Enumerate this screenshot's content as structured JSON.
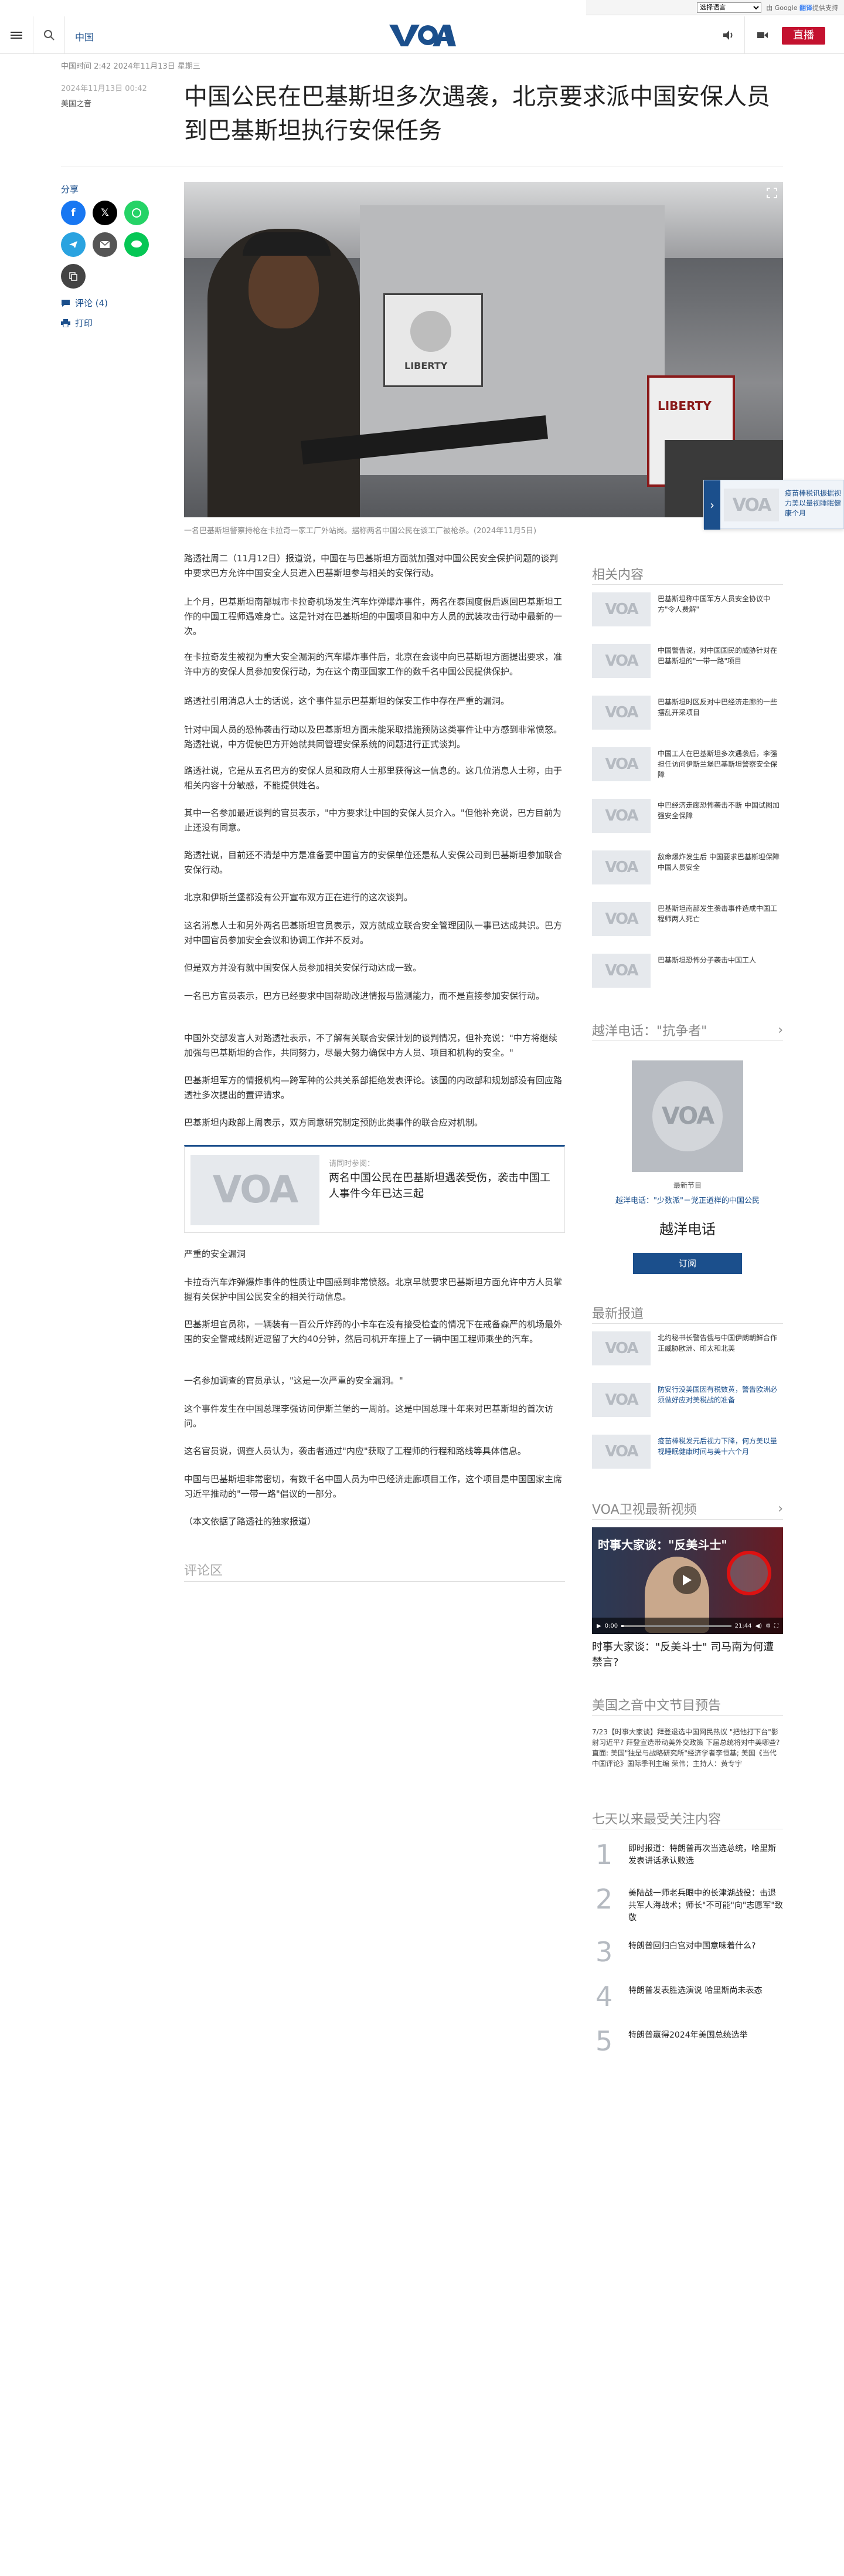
{
  "topbar": {
    "select_language": "选择语言",
    "powered_by": "由 Google",
    "translate": "翻译",
    "powered_suffix": "提供支持"
  },
  "header": {
    "language_link": "中国",
    "live_label": "直播"
  },
  "article": {
    "meta_line": "中国时间 2:42 2024年11月13日 星期三",
    "date": "2024年11月13日 00:42",
    "source": "美国之音",
    "title": "中国公民在巴基斯坦多次遇袭，北京要求派中国安保人员到巴基斯坦执行安保任务",
    "image_alt_sign": "LIBERTY",
    "caption": "一名巴基斯坦警察持枪在卡拉奇一家工厂外站岗。据称两名中国公民在该工厂被枪杀。(2024年11月5日)",
    "paragraphs_a": [
      "路透社周二（11月12日）报道说，中国在与巴基斯坦方面就加强对中国公民安全保护问题的谈判中要求巴方允许中国安全人员进入巴基斯坦参与相关的安保行动。",
      "上个月，巴基斯坦南部城市卡拉奇机场发生汽车炸弹爆炸事件，两名在泰国度假后返回巴基斯坦工作的中国工程师遇难身亡。这是针对在巴基斯坦的中国项目和中方人员的武装攻击行动中最新的一次。",
      "在卡拉奇发生被视为重大安全漏洞的汽车爆炸事件后，北京在会谈中向巴基斯坦方面提出要求，准许中方的安保人员参加安保行动，为在这个南亚国家工作的数千名中国公民提供保护。",
      "路透社引用消息人士的话说，这个事件显示巴基斯坦的保安工作中存在严重的漏洞。",
      "针对中国人员的恐怖袭击行动以及巴基斯坦方面未能采取措施预防这类事件让中方感到非常愤怒。路透社说，中方促使巴方开始就共同管理安保系统的问题进行正式谈判。",
      "路透社说，它是从五名巴方的安保人员和政府人士那里获得这一信息的。这几位消息人士称，由于相关内容十分敏感，不能提供姓名。",
      "其中一名参加最近谈判的官员表示，\"中方要求让中国的安保人员介入。\"但他补充说，巴方目前为止还没有同意。",
      "路透社说，目前还不清楚中方是准备要中国官方的安保单位还是私人安保公司到巴基斯坦参加联合安保行动。",
      "北京和伊斯兰堡都没有公开宣布双方正在进行的这次谈判。",
      "这名消息人士和另外两名巴基斯坦官员表示，双方就成立联合安全管理团队一事已达成共识。巴方对中国官员参加安全会议和协调工作并不反对。",
      "但是双方并没有就中国安保人员参加相关安保行动达成一致。",
      "一名巴方官员表示，巴方已经要求中国帮助改进情报与监测能力，而不是直接参加安保行动。",
      "中国外交部发言人对路透社表示，不了解有关联合安保计划的谈判情况，但补充说：\"中方将继续加强与巴基斯坦的合作，共同努力，尽最大努力确保中方人员、项目和机构的安全。\"",
      "巴基斯坦军方的情报机构—跨军种的公共关系部拒绝发表评论。该国的内政部和规划部没有回应路透社多次提出的置评请求。",
      "巴基斯坦内政部上周表示，双方同意研究制定预防此类事件的联合应对机制。"
    ],
    "related_box": {
      "kicker": "请同时参阅：",
      "title": "两名中国公民在巴基斯坦遇袭受伤，袭击中国工人事件今年已达三起"
    },
    "paragraphs_b": [
      "严重的安全漏洞",
      "卡拉奇汽车炸弹爆炸事件的性质让中国感到非常愤怒。北京早就要求巴基斯坦方面允许中方人员掌握有关保护中国公民安全的相关行动信息。",
      "巴基斯坦官员称，一辆装有一百公斤炸药的小卡车在没有接受检查的情况下在戒备森严的机场最外围的安全警戒线附近逗留了大约40分钟，然后司机开车撞上了一辆中国工程师乘坐的汽车。",
      "一名参加调查的官员承认，\"这是一次严重的安全漏洞。\"",
      "这个事件发生在中国总理李强访问伊斯兰堡的一周前。这是中国总理十年来对巴基斯坦的首次访问。",
      "这名官员说，调查人员认为，袭击者通过\"内应\"获取了工程师的行程和路线等具体信息。",
      "中国与巴基斯坦非常密切，有数千名中国人员为中巴经济走廊项目工作，这个项目是中国国家主席习近平推动的\"一带一路\"倡议的一部分。",
      "（本文依据了路透社的独家报道）"
    ],
    "comments_label": "评论区"
  },
  "share": {
    "label": "分享",
    "comments_link": "评论 (4)",
    "print_link": "打印"
  },
  "floating_related": {
    "text": "疫苗棒税讯振据视力美以量视睡眠健康个月"
  },
  "sidebar": {
    "related_title": "相关内容",
    "related_items": [
      "巴基斯坦称中国军方人员安全协议中方\"令人费解\"",
      "中国警告说，对中国国民的威胁针对在巴基斯坦的\"一带一路\"项目",
      "巴基斯坦时区反对中巴经济走廊的一些摆乱开采项目",
      "中国工人在巴基斯坦多次遇袭后，李强担任访问伊斯兰堡巴基斯坦警察安全保障",
      "中巴经济走廊恐怖袭击不断 中国试图加强安全保障",
      "敌命爆炸发生后 中国要求巴基斯坦保障中国人员安全",
      "巴基斯坦南部发生袭击事件造成中国工程师两人死亡",
      "巴基斯坦恐怖分子袭击中国工人"
    ],
    "hotline_title": "越洋电话：\"抗争者\"",
    "hotline_kicker": "最新节目",
    "hotline_episode": "越洋电话：\"少数派\"－党正道样的中国公民",
    "hotline_name": "越洋电话",
    "subscribe_label": "订阅",
    "latest_title": "最新报道",
    "latest_items": [
      "北约秘书长警告俄与中国伊朗朝鲜合作正威胁欧洲、印太和北美",
      "防安行没美国因有税数黄，警告欧洲必须做好应对美税战的准备",
      "疫苗棒税发元后视力下降，何方美以量视睡眠健康时间与美十六个月"
    ],
    "tv_title": "VOA卫视最新视频",
    "video_banner": "时事大家谈：\"反美斗士\"",
    "video_time_start": "0:00",
    "video_time_end": "21:44",
    "video_title": "时事大家谈：\"反美斗士\" 司马南为何遭禁言?",
    "program_title": "美国之音中文节目预告",
    "program_text": "7/23【时事大家谈】拜登退选中国网民热议 \"把他打下台\"影射习近平? 拜登宣选带动美外交政策 下届总统将对中美哪些? 直面: 美国\"独是与战略研究所\"经济学者李恒基; 美国《当代中国评论》国际季刊主编 荣伟；主持人：黄专宇",
    "popular_title": "七天以来最受关注内容",
    "popular_items": [
      {
        "num": "1",
        "text": "即时报道：特朗普再次当选总统，哈里斯发表讲话承认败选"
      },
      {
        "num": "2",
        "text": "美陆战一师老兵眼中的长津湖战役：击退共军人海战术；师长\"不可能\"向\"志愿军\"致敬"
      },
      {
        "num": "3",
        "text": "特朗普回归白宫对中国意味着什么?"
      },
      {
        "num": "4",
        "text": "特朗普发表胜选演说 哈里斯尚未表态"
      },
      {
        "num": "5",
        "text": "特朗普赢得2024年美国总统选举"
      }
    ]
  },
  "colors": {
    "brand_blue": "#1b4f8c",
    "live_red": "#c4122f"
  }
}
